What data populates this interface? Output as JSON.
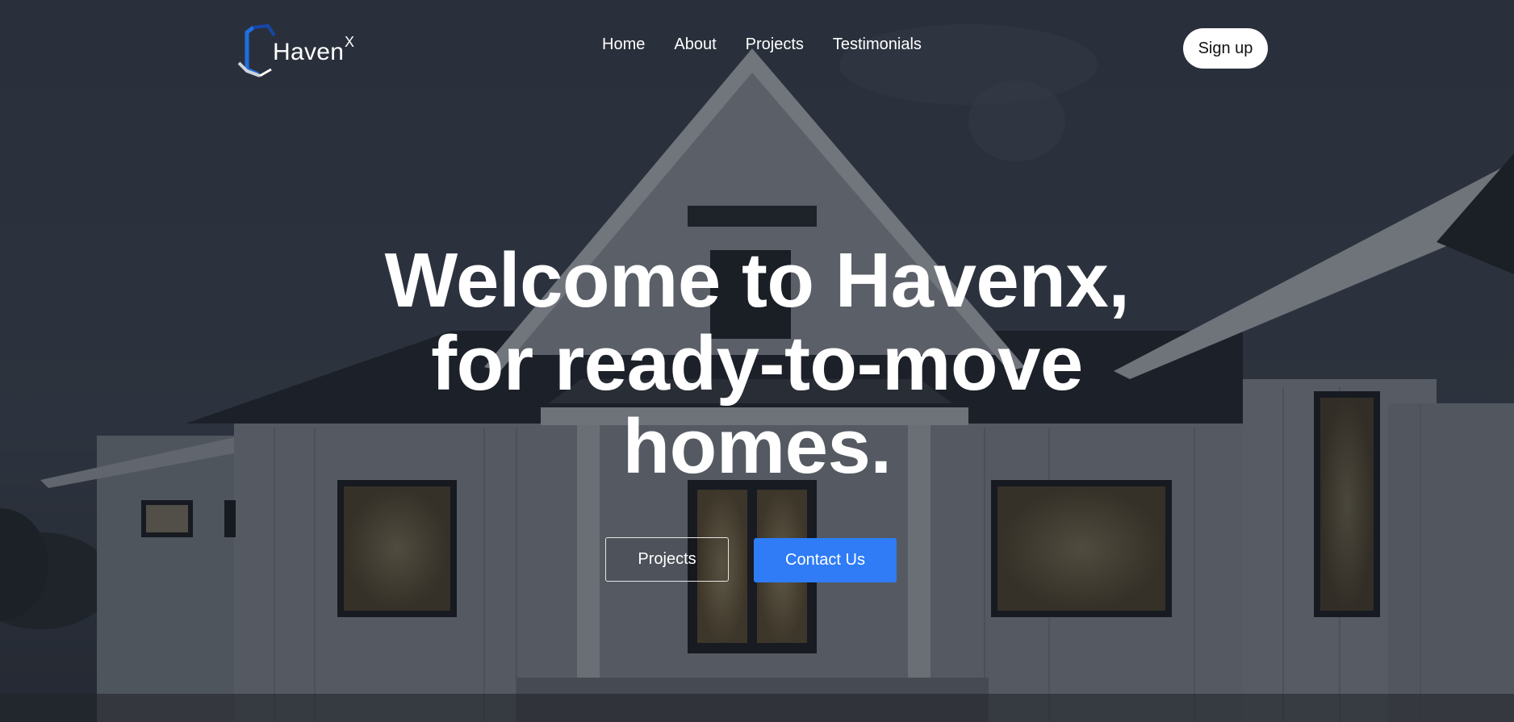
{
  "brand": {
    "name": "Haven",
    "superscript": "X",
    "logo_colors": [
      "#1e6fe0",
      "#1646a8",
      "#cfd3da",
      "#ffffff"
    ]
  },
  "nav": {
    "links": [
      "Home",
      "About",
      "Projects",
      "Testimonials"
    ],
    "signup_label": "Sign up"
  },
  "hero": {
    "headline_lines": [
      "Welcome to Havenx,",
      "for ready-to-move",
      "homes."
    ],
    "background": "photo of white farmhouse at dusk, dark overlay",
    "buttons": {
      "projects_label": "Projects",
      "contact_label": "Contact Us"
    }
  },
  "colors": {
    "accent": "#2f7cf6",
    "text": "#ffffff",
    "overlay": "#1c2029"
  }
}
